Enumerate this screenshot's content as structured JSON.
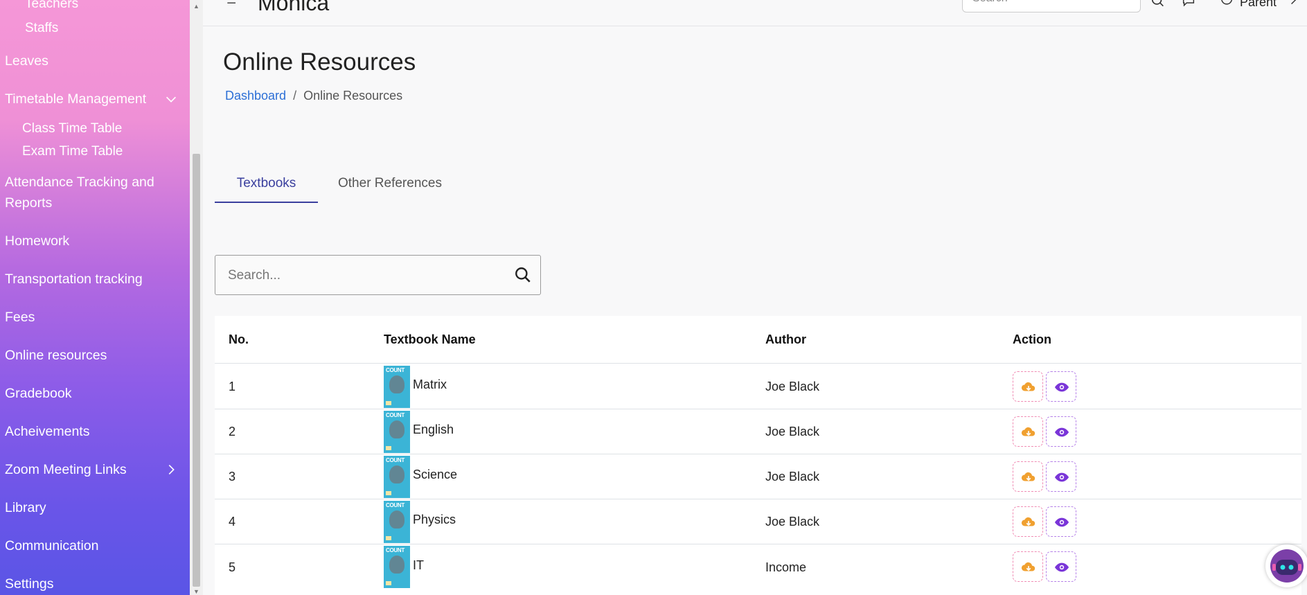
{
  "sidebar": {
    "items": [
      {
        "label": "Teachers",
        "type": "sub"
      },
      {
        "label": "Staffs",
        "type": "sub"
      },
      {
        "label": "Leaves",
        "type": "item"
      },
      {
        "label": "Timetable Management",
        "type": "item",
        "chevron": "chevron-down-icon"
      },
      {
        "label": "Class Time Table",
        "type": "sub"
      },
      {
        "label": "Exam Time Table",
        "type": "sub"
      },
      {
        "label": "Attendance Tracking and",
        "type": "item"
      },
      {
        "label": "Reports",
        "type": "item-cont"
      },
      {
        "label": "Homework",
        "type": "item"
      },
      {
        "label": "Transportation tracking",
        "type": "item"
      },
      {
        "label": "Fees",
        "type": "item"
      },
      {
        "label": "Online resources",
        "type": "item"
      },
      {
        "label": "Gradebook",
        "type": "item"
      },
      {
        "label": "Acheivements",
        "type": "item"
      },
      {
        "label": "Zoom Meeting Links",
        "type": "item",
        "chevron": "chevron-right-icon"
      },
      {
        "label": "Library",
        "type": "item"
      },
      {
        "label": "Communication",
        "type": "item"
      },
      {
        "label": "Settings",
        "type": "item"
      }
    ]
  },
  "header": {
    "brand": "Monica",
    "search_placeholder": "Search",
    "user_label": "Parent"
  },
  "page": {
    "title": "Online Resources",
    "breadcrumb": {
      "home": "Dashboard",
      "sep": "/",
      "current": "Online Resources"
    }
  },
  "tabs": [
    {
      "label": "Textbooks",
      "active": true
    },
    {
      "label": "Other References",
      "active": false
    }
  ],
  "search": {
    "placeholder": "Search..."
  },
  "table": {
    "headers": [
      "No.",
      "Textbook Name",
      "Author",
      "Action"
    ],
    "cover_text": "COUNT",
    "rows": [
      {
        "no": "1",
        "name": "Matrix",
        "author": "Joe Black"
      },
      {
        "no": "2",
        "name": "English",
        "author": "Joe Black"
      },
      {
        "no": "3",
        "name": "Science",
        "author": "Joe Black"
      },
      {
        "no": "4",
        "name": "Physics",
        "author": "Joe Black"
      },
      {
        "no": "5",
        "name": "IT",
        "author": "Income"
      }
    ]
  },
  "colors": {
    "accent": "#3a3f9e",
    "link": "#2c6fd6",
    "download": "#f0a030",
    "view": "#7a35d8"
  }
}
